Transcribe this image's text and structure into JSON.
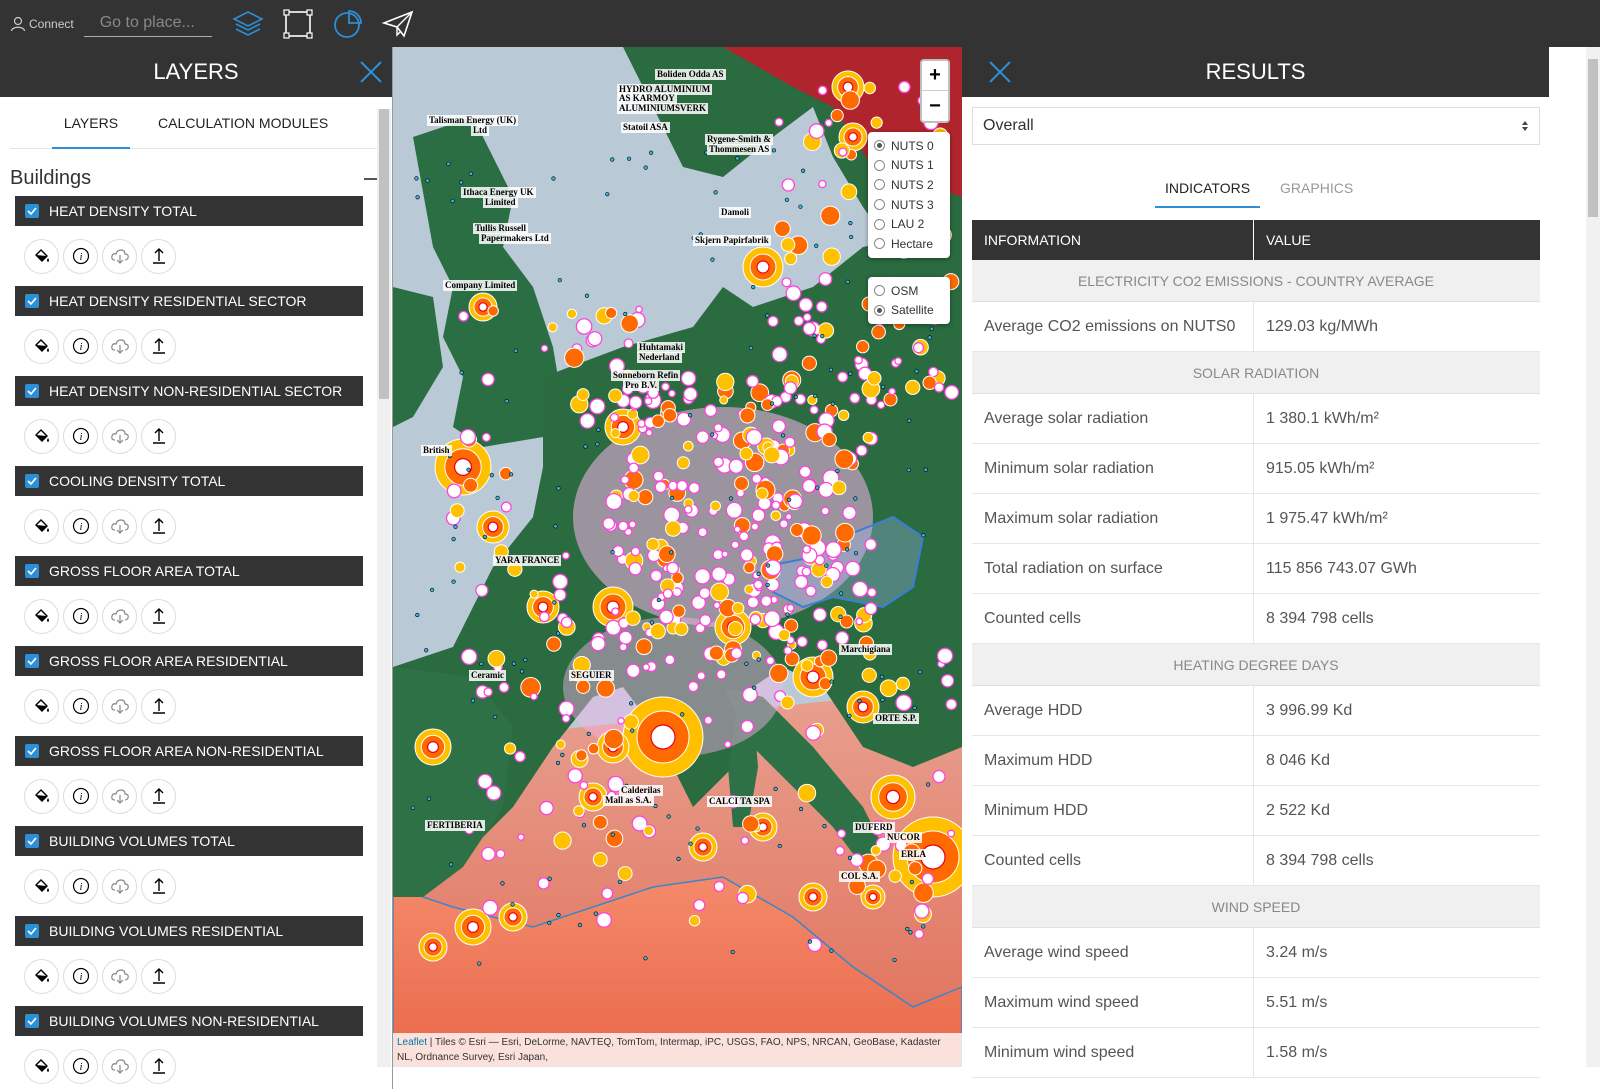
{
  "topbar": {
    "connect_label": "Connect",
    "search_placeholder": "Go to place..."
  },
  "left_panel": {
    "title": "LAYERS",
    "tabs": [
      "LAYERS",
      "CALCULATION MODULES"
    ],
    "section_title": "Buildings",
    "layers": [
      "HEAT DENSITY TOTAL",
      "HEAT DENSITY RESIDENTIAL SECTOR",
      "HEAT DENSITY NON-RESIDENTIAL SECTOR",
      "COOLING DENSITY TOTAL",
      "GROSS FLOOR AREA TOTAL",
      "GROSS FLOOR AREA RESIDENTIAL",
      "GROSS FLOOR AREA NON-RESIDENTIAL",
      "BUILDING VOLUMES TOTAL",
      "BUILDING VOLUMES RESIDENTIAL",
      "BUILDING VOLUMES NON-RESIDENTIAL"
    ]
  },
  "map": {
    "zoom_in": "+",
    "zoom_out": "−",
    "levels": [
      "NUTS 0",
      "NUTS 1",
      "NUTS 2",
      "NUTS 3",
      "LAU 2",
      "Hectare"
    ],
    "selected_level": "NUTS 0",
    "basemaps": [
      "OSM",
      "Satellite"
    ],
    "selected_basemap": "Satellite",
    "attribution_link": "Leaflet",
    "attribution_text": " | Tiles © Esri — Esri, DeLorme, NAVTEQ, TomTom, Intermap, iPC, USGS, FAO, NPS, NRCAN, GeoBase, Kadaster NL, Ordnance Survey, Esri Japan,",
    "labels": [
      "Boliden Odda AS",
      "HYDRO ALUMINIUM",
      "AS KARMOY",
      "ALUMINIUMSVERK",
      "Talisman Energy (UK)",
      "Ltd",
      "Statoil ASA",
      "Rygene-Smith &",
      "Thommesen AS",
      "Ithaca Energy UK",
      "Limited",
      "Tullis Russell",
      "Papermakers Ltd",
      "Damoli",
      "Skjern Papirfabrik",
      "Company Limited",
      "Huhtamaki",
      "Nederland",
      "Sonneborn Refin",
      "Pro B.V.",
      "British",
      "YARA FRANCE",
      "Ceramic",
      "SEGUIER",
      "Marchigiana",
      "ORTE S.P.",
      "Calderilas",
      "Mall as S.A.",
      "CALCI TA SPA",
      "FERTIBERIA",
      "DUFERD",
      "NUCOR",
      "ERLA",
      "COL S.A."
    ],
    "colors": {
      "sea": "#b8c8d6",
      "land": "#2a6b40",
      "heat_orange": "#ff6a00",
      "heat_yellow": "#ffc000",
      "heat_red": "#e8001c",
      "marker_pink": "#ff44dd",
      "sahara": "#f07b5a",
      "region_outline": "#3a7fd5"
    }
  },
  "right_panel": {
    "title": "RESULTS",
    "selector_value": "Overall",
    "tabs": [
      "INDICATORS",
      "GRAPHICS"
    ],
    "table_headers": [
      "INFORMATION",
      "VALUE"
    ],
    "groups": [
      {
        "title": "ELECTRICITY CO2 EMISSIONS - COUNTRY AVERAGE",
        "rows": [
          {
            "label": "Average CO2 emissions on NUTS0",
            "value": "129.03 kg/MWh"
          }
        ]
      },
      {
        "title": "SOLAR RADIATION",
        "rows": [
          {
            "label": "Average solar radiation",
            "value": "1 380.1 kWh/m²"
          },
          {
            "label": "Minimum solar radiation",
            "value": "915.05 kWh/m²"
          },
          {
            "label": "Maximum solar radiation",
            "value": "1 975.47 kWh/m²"
          },
          {
            "label": "Total radiation on surface",
            "value": "115 856 743.07 GWh"
          },
          {
            "label": "Counted cells",
            "value": "8 394 798 cells"
          }
        ]
      },
      {
        "title": "HEATING DEGREE DAYS",
        "rows": [
          {
            "label": "Average HDD",
            "value": "3 996.99 Kd"
          },
          {
            "label": "Maximum HDD",
            "value": "8 046 Kd"
          },
          {
            "label": "Minimum HDD",
            "value": "2 522 Kd"
          },
          {
            "label": "Counted cells",
            "value": "8 394 798 cells"
          }
        ]
      },
      {
        "title": "WIND SPEED",
        "rows": [
          {
            "label": "Average wind speed",
            "value": "3.24 m/s"
          },
          {
            "label": "Maximum wind speed",
            "value": "5.51 m/s"
          },
          {
            "label": "Minimum wind speed",
            "value": "1.58 m/s"
          }
        ]
      }
    ]
  }
}
